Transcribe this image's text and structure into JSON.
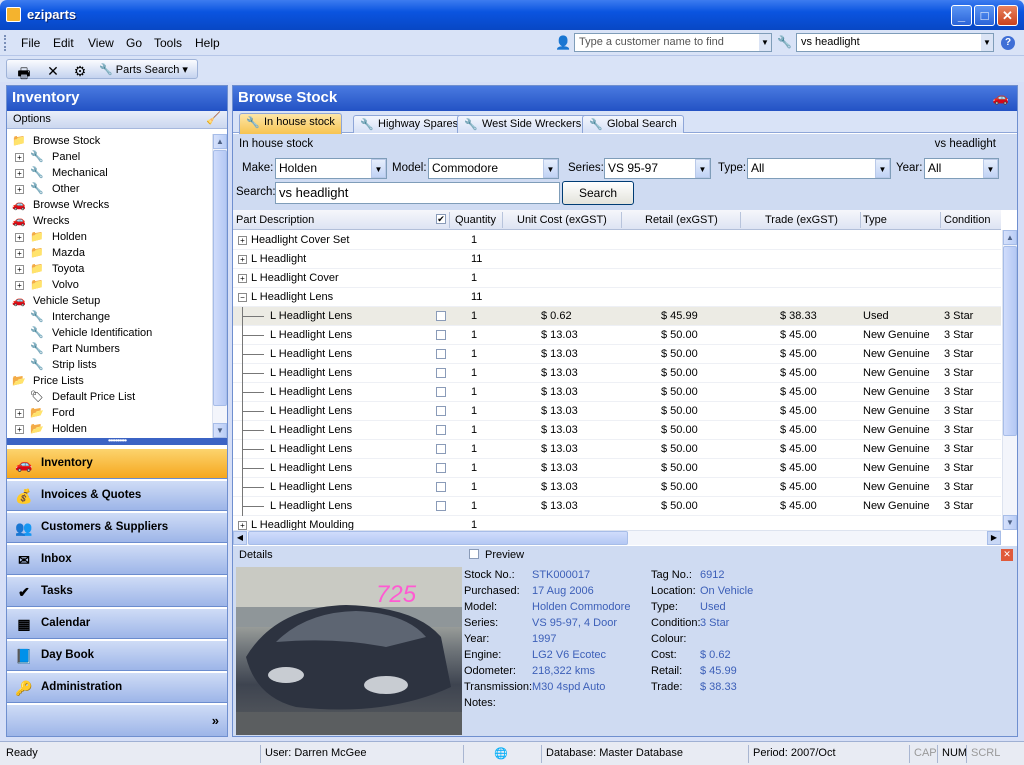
{
  "app": {
    "title": "eziparts"
  },
  "menu": [
    "File",
    "Edit",
    "View",
    "Go",
    "Tools",
    "Help"
  ],
  "find": {
    "customer_placeholder": "Type a customer name to find",
    "search_value": "vs headlight",
    "help": "?"
  },
  "toolbar": {
    "parts_search": "Parts Search"
  },
  "left": {
    "header": "Inventory",
    "options": "Options",
    "tree": [
      {
        "label": "Browse Stock",
        "level": 0,
        "expander": "",
        "icon": "📁"
      },
      {
        "label": "Panel",
        "level": 1,
        "expander": "+",
        "icon": "🔧"
      },
      {
        "label": "Mechanical",
        "level": 1,
        "expander": "+",
        "icon": "🔧"
      },
      {
        "label": "Other",
        "level": 1,
        "expander": "+",
        "icon": "🔧"
      },
      {
        "label": "Browse Wrecks",
        "level": 0,
        "expander": "",
        "icon": "🚗"
      },
      {
        "label": "Wrecks",
        "level": 0,
        "expander": "",
        "icon": "🚗"
      },
      {
        "label": "Holden",
        "level": 1,
        "expander": "+",
        "icon": "📁"
      },
      {
        "label": "Mazda",
        "level": 1,
        "expander": "+",
        "icon": "📁"
      },
      {
        "label": "Toyota",
        "level": 1,
        "expander": "+",
        "icon": "📁"
      },
      {
        "label": "Volvo",
        "level": 1,
        "expander": "+",
        "icon": "📁"
      },
      {
        "label": "Vehicle Setup",
        "level": 0,
        "expander": "",
        "icon": "🚗"
      },
      {
        "label": "Interchange",
        "level": 1,
        "expander": "",
        "icon": "🔧"
      },
      {
        "label": "Vehicle Identification",
        "level": 1,
        "expander": "",
        "icon": "🔧"
      },
      {
        "label": "Part Numbers",
        "level": 1,
        "expander": "",
        "icon": "🔧"
      },
      {
        "label": "Strip lists",
        "level": 1,
        "expander": "",
        "icon": "🔧"
      },
      {
        "label": "Price Lists",
        "level": 0,
        "expander": "",
        "icon": "📂"
      },
      {
        "label": "Default Price List",
        "level": 1,
        "expander": "",
        "icon": "🏷"
      },
      {
        "label": "Ford",
        "level": 1,
        "expander": "+",
        "icon": "📂"
      },
      {
        "label": "Holden",
        "level": 1,
        "expander": "+",
        "icon": "📂"
      }
    ],
    "nav": [
      {
        "label": "Inventory",
        "icon": "🚗"
      },
      {
        "label": "Invoices & Quotes",
        "icon": "💰"
      },
      {
        "label": "Customers & Suppliers",
        "icon": "👥"
      },
      {
        "label": "Inbox",
        "icon": "✉"
      },
      {
        "label": "Tasks",
        "icon": "✔"
      },
      {
        "label": "Calendar",
        "icon": "▦"
      },
      {
        "label": "Day Book",
        "icon": "📘"
      },
      {
        "label": "Administration",
        "icon": "🔑"
      }
    ],
    "more": "»"
  },
  "browse": {
    "header": "Browse Stock",
    "tabs": [
      "In house stock",
      "Highway Spares",
      "West Side Wreckers",
      "Global Search"
    ],
    "context_left": "In house stock",
    "context_right": "vs headlight",
    "filters": {
      "make_label": "Make:",
      "make": "Holden",
      "model_label": "Model:",
      "model": "Commodore",
      "series_label": "Series:",
      "series": "VS 95-97",
      "type_label": "Type:",
      "type": "All",
      "year_label": "Year:",
      "year": "All",
      "search_label": "Search:",
      "search": "vs headlight",
      "search_button": "Search"
    },
    "columns": [
      "Part Description",
      "Quantity",
      "Unit Cost (exGST)",
      "Retail (exGST)",
      "Trade (exGST)",
      "Type",
      "Condition"
    ],
    "rows": [
      {
        "desc": "Headlight Cover Set",
        "group": true,
        "exp": "+",
        "qty": "1",
        "cost": "",
        "retail": "",
        "trade": "",
        "type": "",
        "cond": ""
      },
      {
        "desc": "L Headlight",
        "group": true,
        "exp": "+",
        "qty": "11",
        "cost": "",
        "retail": "",
        "trade": "",
        "type": "",
        "cond": ""
      },
      {
        "desc": "L Headlight Cover",
        "group": true,
        "exp": "+",
        "qty": "1",
        "cost": "",
        "retail": "",
        "trade": "",
        "type": "",
        "cond": ""
      },
      {
        "desc": "L Headlight Lens",
        "group": true,
        "exp": "−",
        "qty": "11",
        "cost": "",
        "retail": "",
        "trade": "",
        "type": "",
        "cond": ""
      },
      {
        "desc": "L Headlight Lens",
        "group": false,
        "qty": "1",
        "cost": "$ 0.62",
        "retail": "$ 45.99",
        "trade": "$ 38.33",
        "type": "Used",
        "cond": "3 Star",
        "sel": true
      },
      {
        "desc": "L Headlight Lens",
        "group": false,
        "qty": "1",
        "cost": "$ 13.03",
        "retail": "$ 50.00",
        "trade": "$ 45.00",
        "type": "New Genuine",
        "cond": "3 Star"
      },
      {
        "desc": "L Headlight Lens",
        "group": false,
        "qty": "1",
        "cost": "$ 13.03",
        "retail": "$ 50.00",
        "trade": "$ 45.00",
        "type": "New Genuine",
        "cond": "3 Star"
      },
      {
        "desc": "L Headlight Lens",
        "group": false,
        "qty": "1",
        "cost": "$ 13.03",
        "retail": "$ 50.00",
        "trade": "$ 45.00",
        "type": "New Genuine",
        "cond": "3 Star"
      },
      {
        "desc": "L Headlight Lens",
        "group": false,
        "qty": "1",
        "cost": "$ 13.03",
        "retail": "$ 50.00",
        "trade": "$ 45.00",
        "type": "New Genuine",
        "cond": "3 Star"
      },
      {
        "desc": "L Headlight Lens",
        "group": false,
        "qty": "1",
        "cost": "$ 13.03",
        "retail": "$ 50.00",
        "trade": "$ 45.00",
        "type": "New Genuine",
        "cond": "3 Star"
      },
      {
        "desc": "L Headlight Lens",
        "group": false,
        "qty": "1",
        "cost": "$ 13.03",
        "retail": "$ 50.00",
        "trade": "$ 45.00",
        "type": "New Genuine",
        "cond": "3 Star"
      },
      {
        "desc": "L Headlight Lens",
        "group": false,
        "qty": "1",
        "cost": "$ 13.03",
        "retail": "$ 50.00",
        "trade": "$ 45.00",
        "type": "New Genuine",
        "cond": "3 Star"
      },
      {
        "desc": "L Headlight Lens",
        "group": false,
        "qty": "1",
        "cost": "$ 13.03",
        "retail": "$ 50.00",
        "trade": "$ 45.00",
        "type": "New Genuine",
        "cond": "3 Star"
      },
      {
        "desc": "L Headlight Lens",
        "group": false,
        "qty": "1",
        "cost": "$ 13.03",
        "retail": "$ 50.00",
        "trade": "$ 45.00",
        "type": "New Genuine",
        "cond": "3 Star"
      },
      {
        "desc": "L Headlight Lens",
        "group": false,
        "qty": "1",
        "cost": "$ 13.03",
        "retail": "$ 50.00",
        "trade": "$ 45.00",
        "type": "New Genuine",
        "cond": "3 Star"
      },
      {
        "desc": "L Headlight Moulding",
        "group": true,
        "exp": "+",
        "qty": "1",
        "cost": "",
        "retail": "",
        "trade": "",
        "type": "",
        "cond": ""
      }
    ]
  },
  "details": {
    "title": "Details",
    "preview": "Preview",
    "photo_text": "725",
    "left": [
      {
        "label": "Stock No.:",
        "value": "STK000017"
      },
      {
        "label": "Purchased:",
        "value": "17 Aug 2006"
      },
      {
        "label": "Model:",
        "value": "Holden Commodore"
      },
      {
        "label": "Series:",
        "value": "VS 95-97, 4 Door"
      },
      {
        "label": "Year:",
        "value": "1997"
      },
      {
        "label": "Engine:",
        "value": "LG2 V6 Ecotec"
      },
      {
        "label": "Odometer:",
        "value": "218,322 kms"
      },
      {
        "label": "Transmission:",
        "value": "M30 4spd Auto"
      },
      {
        "label": "Notes:",
        "value": ""
      }
    ],
    "right": [
      {
        "label": "Tag No.:",
        "value": "6912"
      },
      {
        "label": "Location:",
        "value": "On Vehicle"
      },
      {
        "label": "Type:",
        "value": "Used"
      },
      {
        "label": "Condition:",
        "value": "3 Star"
      },
      {
        "label": "Colour:",
        "value": ""
      },
      {
        "label": "Cost:",
        "value": "$ 0.62"
      },
      {
        "label": "Retail:",
        "value": "$ 45.99"
      },
      {
        "label": "Trade:",
        "value": "$ 38.33"
      }
    ]
  },
  "status": {
    "ready": "Ready",
    "user": "User: Darren McGee",
    "database": "Database: Master Database",
    "period": "Period: 2007/Oct",
    "cap": "CAP",
    "num": "NUM",
    "scrl": "SCRL"
  }
}
